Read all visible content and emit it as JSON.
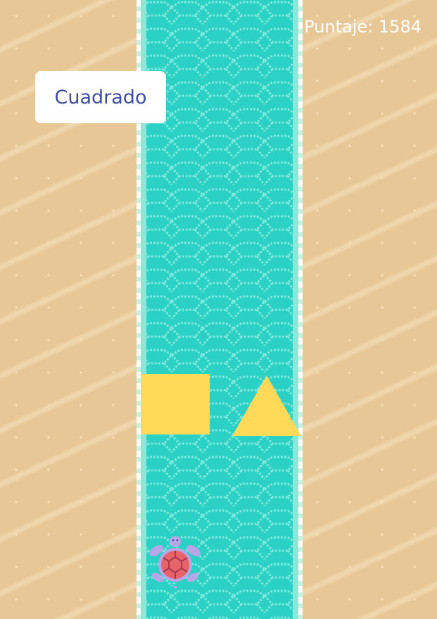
{
  "hud": {
    "score_text": "Puntaje: 1584"
  },
  "prompt": {
    "shape_name": "Cuadrado"
  },
  "choices": [
    {
      "shape": "square",
      "color": "#ffd958"
    },
    {
      "shape": "triangle",
      "color": "#ffd958"
    }
  ],
  "player": {
    "icon": "turtle-icon",
    "shell_color": "#e8626a",
    "body_color": "#b8a6e8"
  },
  "colors": {
    "sand": "#e8c796",
    "water": "#2bd1c5",
    "label_text": "#3f4da0",
    "score_text": "#ffffff"
  }
}
